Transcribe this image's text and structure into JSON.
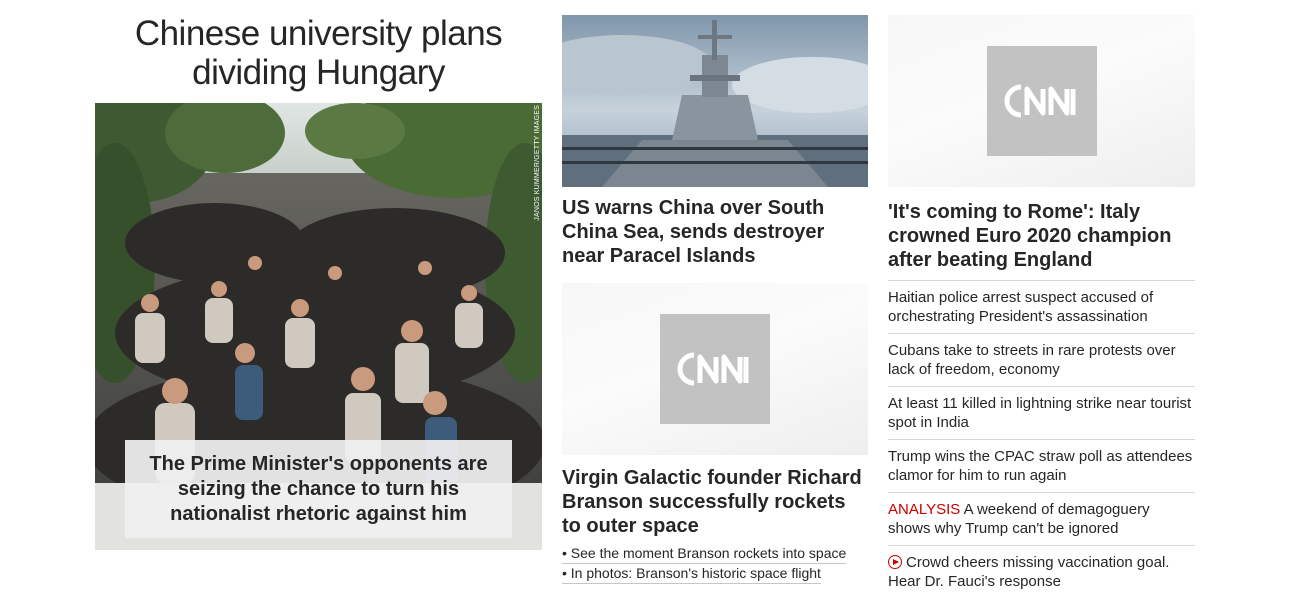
{
  "col1": {
    "title": "Chinese university plans dividing Hungary",
    "image_credit": "JANOS KUMMER/GETTY IMAGES",
    "caption": "The Prime Minister's opponents are seizing the chance to turn his nationalist rhetoric against him"
  },
  "col2": {
    "story1": {
      "headline": "US warns China over South China Sea, sends destroyer near Paracel Islands"
    },
    "story2": {
      "image_logo": "CNN",
      "headline": "Virgin Galactic founder Richard Branson successfully rockets to outer space",
      "links": [
        "• See the moment Branson rockets into space",
        "• In photos: Branson's historic space flight"
      ]
    }
  },
  "col3": {
    "image_logo": "CNN",
    "headline": "'It's coming to Rome': Italy crowned Euro 2020 champion after beating England",
    "items": [
      {
        "text": "Haitian police arrest suspect accused of orchestrating President's assassination"
      },
      {
        "text": "Cubans take to streets in rare protests over lack of freedom, economy"
      },
      {
        "text": "At least 11 killed in lightning strike near tourist spot in India"
      },
      {
        "text": "Trump wins the CPAC straw poll as attendees clamor for him to run again"
      },
      {
        "label": "ANALYSIS",
        "text": " A weekend of demagoguery shows why Trump can't be ignored"
      },
      {
        "icon": "play-icon",
        "text": "Crowd cheers missing vaccination goal. Hear Dr. Fauci's response"
      }
    ]
  },
  "colors": {
    "text": "#262626",
    "accent_red": "#cc0000",
    "divider": "#d8d8d8",
    "placeholder_logo_bg": "#c2c2c2"
  }
}
